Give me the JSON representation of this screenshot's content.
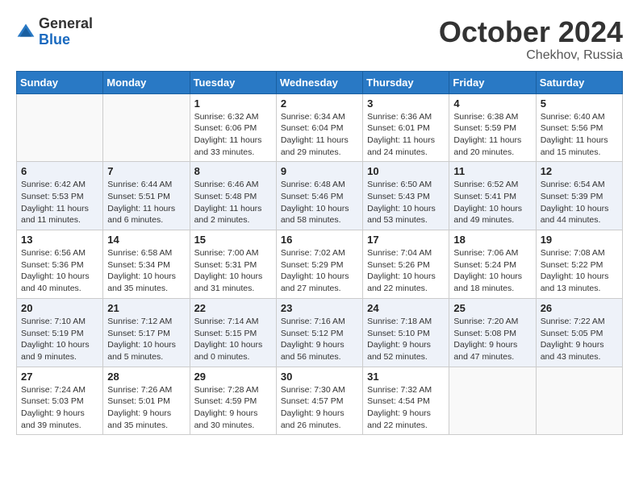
{
  "logo": {
    "general": "General",
    "blue": "Blue"
  },
  "title": "October 2024",
  "subtitle": "Chekhov, Russia",
  "weekdays": [
    "Sunday",
    "Monday",
    "Tuesday",
    "Wednesday",
    "Thursday",
    "Friday",
    "Saturday"
  ],
  "weeks": [
    [
      {
        "day": "",
        "sunrise": "",
        "sunset": "",
        "daylight": ""
      },
      {
        "day": "",
        "sunrise": "",
        "sunset": "",
        "daylight": ""
      },
      {
        "day": "1",
        "sunrise": "Sunrise: 6:32 AM",
        "sunset": "Sunset: 6:06 PM",
        "daylight": "Daylight: 11 hours and 33 minutes."
      },
      {
        "day": "2",
        "sunrise": "Sunrise: 6:34 AM",
        "sunset": "Sunset: 6:04 PM",
        "daylight": "Daylight: 11 hours and 29 minutes."
      },
      {
        "day": "3",
        "sunrise": "Sunrise: 6:36 AM",
        "sunset": "Sunset: 6:01 PM",
        "daylight": "Daylight: 11 hours and 24 minutes."
      },
      {
        "day": "4",
        "sunrise": "Sunrise: 6:38 AM",
        "sunset": "Sunset: 5:59 PM",
        "daylight": "Daylight: 11 hours and 20 minutes."
      },
      {
        "day": "5",
        "sunrise": "Sunrise: 6:40 AM",
        "sunset": "Sunset: 5:56 PM",
        "daylight": "Daylight: 11 hours and 15 minutes."
      }
    ],
    [
      {
        "day": "6",
        "sunrise": "Sunrise: 6:42 AM",
        "sunset": "Sunset: 5:53 PM",
        "daylight": "Daylight: 11 hours and 11 minutes."
      },
      {
        "day": "7",
        "sunrise": "Sunrise: 6:44 AM",
        "sunset": "Sunset: 5:51 PM",
        "daylight": "Daylight: 11 hours and 6 minutes."
      },
      {
        "day": "8",
        "sunrise": "Sunrise: 6:46 AM",
        "sunset": "Sunset: 5:48 PM",
        "daylight": "Daylight: 11 hours and 2 minutes."
      },
      {
        "day": "9",
        "sunrise": "Sunrise: 6:48 AM",
        "sunset": "Sunset: 5:46 PM",
        "daylight": "Daylight: 10 hours and 58 minutes."
      },
      {
        "day": "10",
        "sunrise": "Sunrise: 6:50 AM",
        "sunset": "Sunset: 5:43 PM",
        "daylight": "Daylight: 10 hours and 53 minutes."
      },
      {
        "day": "11",
        "sunrise": "Sunrise: 6:52 AM",
        "sunset": "Sunset: 5:41 PM",
        "daylight": "Daylight: 10 hours and 49 minutes."
      },
      {
        "day": "12",
        "sunrise": "Sunrise: 6:54 AM",
        "sunset": "Sunset: 5:39 PM",
        "daylight": "Daylight: 10 hours and 44 minutes."
      }
    ],
    [
      {
        "day": "13",
        "sunrise": "Sunrise: 6:56 AM",
        "sunset": "Sunset: 5:36 PM",
        "daylight": "Daylight: 10 hours and 40 minutes."
      },
      {
        "day": "14",
        "sunrise": "Sunrise: 6:58 AM",
        "sunset": "Sunset: 5:34 PM",
        "daylight": "Daylight: 10 hours and 35 minutes."
      },
      {
        "day": "15",
        "sunrise": "Sunrise: 7:00 AM",
        "sunset": "Sunset: 5:31 PM",
        "daylight": "Daylight: 10 hours and 31 minutes."
      },
      {
        "day": "16",
        "sunrise": "Sunrise: 7:02 AM",
        "sunset": "Sunset: 5:29 PM",
        "daylight": "Daylight: 10 hours and 27 minutes."
      },
      {
        "day": "17",
        "sunrise": "Sunrise: 7:04 AM",
        "sunset": "Sunset: 5:26 PM",
        "daylight": "Daylight: 10 hours and 22 minutes."
      },
      {
        "day": "18",
        "sunrise": "Sunrise: 7:06 AM",
        "sunset": "Sunset: 5:24 PM",
        "daylight": "Daylight: 10 hours and 18 minutes."
      },
      {
        "day": "19",
        "sunrise": "Sunrise: 7:08 AM",
        "sunset": "Sunset: 5:22 PM",
        "daylight": "Daylight: 10 hours and 13 minutes."
      }
    ],
    [
      {
        "day": "20",
        "sunrise": "Sunrise: 7:10 AM",
        "sunset": "Sunset: 5:19 PM",
        "daylight": "Daylight: 10 hours and 9 minutes."
      },
      {
        "day": "21",
        "sunrise": "Sunrise: 7:12 AM",
        "sunset": "Sunset: 5:17 PM",
        "daylight": "Daylight: 10 hours and 5 minutes."
      },
      {
        "day": "22",
        "sunrise": "Sunrise: 7:14 AM",
        "sunset": "Sunset: 5:15 PM",
        "daylight": "Daylight: 10 hours and 0 minutes."
      },
      {
        "day": "23",
        "sunrise": "Sunrise: 7:16 AM",
        "sunset": "Sunset: 5:12 PM",
        "daylight": "Daylight: 9 hours and 56 minutes."
      },
      {
        "day": "24",
        "sunrise": "Sunrise: 7:18 AM",
        "sunset": "Sunset: 5:10 PM",
        "daylight": "Daylight: 9 hours and 52 minutes."
      },
      {
        "day": "25",
        "sunrise": "Sunrise: 7:20 AM",
        "sunset": "Sunset: 5:08 PM",
        "daylight": "Daylight: 9 hours and 47 minutes."
      },
      {
        "day": "26",
        "sunrise": "Sunrise: 7:22 AM",
        "sunset": "Sunset: 5:05 PM",
        "daylight": "Daylight: 9 hours and 43 minutes."
      }
    ],
    [
      {
        "day": "27",
        "sunrise": "Sunrise: 7:24 AM",
        "sunset": "Sunset: 5:03 PM",
        "daylight": "Daylight: 9 hours and 39 minutes."
      },
      {
        "day": "28",
        "sunrise": "Sunrise: 7:26 AM",
        "sunset": "Sunset: 5:01 PM",
        "daylight": "Daylight: 9 hours and 35 minutes."
      },
      {
        "day": "29",
        "sunrise": "Sunrise: 7:28 AM",
        "sunset": "Sunset: 4:59 PM",
        "daylight": "Daylight: 9 hours and 30 minutes."
      },
      {
        "day": "30",
        "sunrise": "Sunrise: 7:30 AM",
        "sunset": "Sunset: 4:57 PM",
        "daylight": "Daylight: 9 hours and 26 minutes."
      },
      {
        "day": "31",
        "sunrise": "Sunrise: 7:32 AM",
        "sunset": "Sunset: 4:54 PM",
        "daylight": "Daylight: 9 hours and 22 minutes."
      },
      {
        "day": "",
        "sunrise": "",
        "sunset": "",
        "daylight": ""
      },
      {
        "day": "",
        "sunrise": "",
        "sunset": "",
        "daylight": ""
      }
    ]
  ]
}
